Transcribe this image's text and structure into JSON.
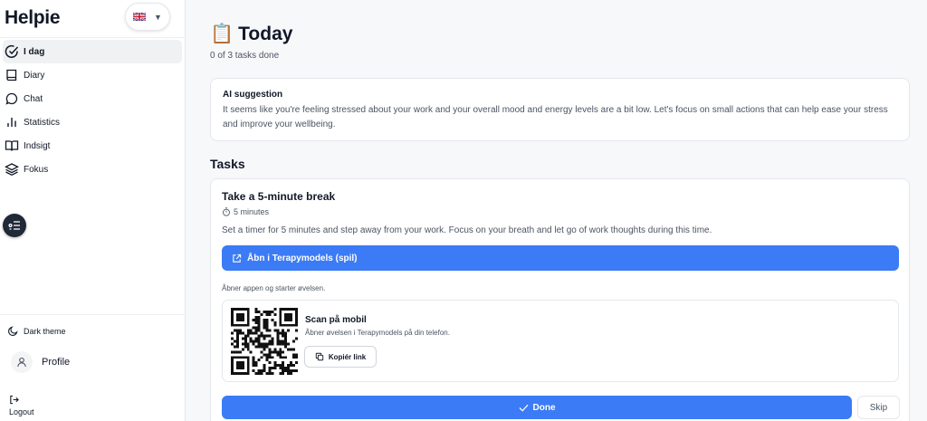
{
  "app": {
    "name": "Helpie",
    "language_flag": "uk-flag-icon"
  },
  "sidebar": {
    "items": [
      {
        "label": "I dag",
        "icon": "check-circle-icon",
        "active": true
      },
      {
        "label": "Diary",
        "icon": "book-icon",
        "active": false
      },
      {
        "label": "Chat",
        "icon": "chat-bubble-icon",
        "active": false
      },
      {
        "label": "Statistics",
        "icon": "bar-chart-icon",
        "active": false
      },
      {
        "label": "Indsigt",
        "icon": "open-book-icon",
        "active": false
      },
      {
        "label": "Fokus",
        "icon": "layers-icon",
        "active": false
      }
    ],
    "theme_label": "Dark theme",
    "profile_label": "Profile",
    "logout_label": "Logout"
  },
  "header": {
    "emoji": "📋",
    "title": "Today",
    "progress": "0 of 3 tasks done"
  },
  "ai": {
    "title": "AI suggestion",
    "text": "It seems like you're feeling stressed about your work and your overall mood and energy levels are a bit low. Let's focus on small actions that can help ease your stress and improve your wellbeing."
  },
  "tasks": {
    "heading": "Tasks",
    "current": {
      "title": "Take a 5-minute break",
      "duration": "5 minutes",
      "description": "Set a timer for 5 minutes and step away from your work. Focus on your breath and let go of work thoughts during this time.",
      "open_label": "Åbn i Terapymodels (spil)",
      "opens_note": "Åbner appen og starter øvelsen.",
      "scan_title": "Scan på mobil",
      "scan_sub": "Åbner øvelsen i Terapymodels på din telefon.",
      "copy_label": "Kopiér link",
      "done_label": "Done",
      "skip_label": "Skip"
    }
  },
  "colors": {
    "primary": "#3b7bf5",
    "text": "#111827",
    "muted": "#4b5563",
    "border": "#e5e7eb"
  }
}
